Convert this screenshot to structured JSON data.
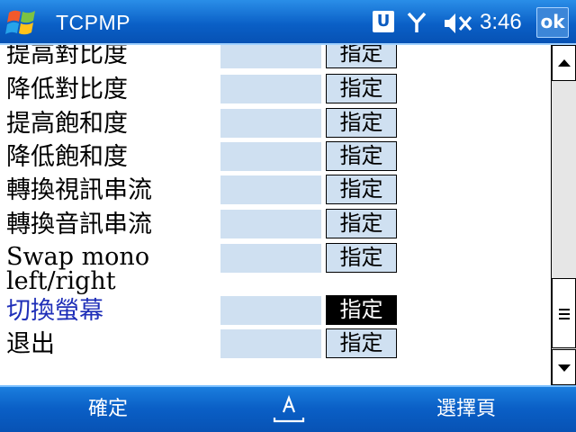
{
  "window": {
    "app_title": "TCPMP",
    "clock": "3:46",
    "ok_label": "ok",
    "notification_letter": "U"
  },
  "icons": {
    "start": "windows-flag-icon",
    "signal": "antenna-signal-icon",
    "volume": "speaker-muted-icon",
    "input": "keyboard-input-icon"
  },
  "colors": {
    "titlebar": "#0a5fc6",
    "key_box": "#cfe0f1",
    "highlight_text": "#1f2fb8",
    "active_button": "#000000"
  },
  "rows": [
    {
      "label": "提高對比度",
      "button": "指定"
    },
    {
      "label": "降低對比度",
      "button": "指定"
    },
    {
      "label": "提高飽和度",
      "button": "指定"
    },
    {
      "label": "降低飽和度",
      "button": "指定"
    },
    {
      "label": "轉換視訊串流",
      "button": "指定"
    },
    {
      "label": "轉換音訊串流",
      "button": "指定"
    },
    {
      "label": "Swap mono left/right",
      "button": "指定"
    },
    {
      "label": "切換螢幕",
      "button": "指定"
    },
    {
      "label": "退出",
      "button": "指定"
    }
  ],
  "menu": {
    "left_label": "確定",
    "right_label": "選擇頁"
  }
}
